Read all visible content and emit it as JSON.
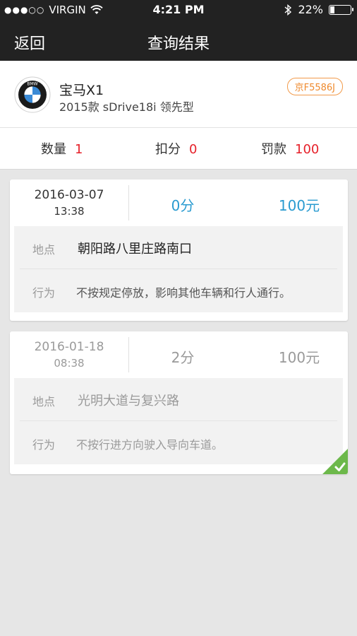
{
  "status_bar": {
    "signal": "●●●○○",
    "carrier": "VIRGIN",
    "time": "4:21 PM",
    "battery": "22%",
    "battery_level": 0.22
  },
  "nav": {
    "back_label": "返回",
    "title": "查询结果"
  },
  "car": {
    "name": "宝马X1",
    "model": "2015款 sDrive18i 领先型",
    "plate": "京F5586J",
    "logo_text": "BMW"
  },
  "summary": {
    "count_label": "数量",
    "count_value": "1",
    "points_label": "扣分",
    "points_value": "0",
    "fine_label": "罚款",
    "fine_value": "100"
  },
  "violations": [
    {
      "date": "2016-03-07",
      "time": "13:38",
      "points": "0分",
      "fine": "100元",
      "location_label": "地点",
      "location": "朝阳路八里庄路南口",
      "action_label": "行为",
      "action": "不按规定停放，影响其他车辆和行人通行。",
      "handled": false
    },
    {
      "date": "2016-01-18",
      "time": "08:38",
      "points": "2分",
      "fine": "100元",
      "location_label": "地点",
      "location": "光明大道与复兴路",
      "action_label": "行为",
      "action": "不按行进方向驶入导向车道。",
      "handled": true
    }
  ],
  "colors": {
    "accent_blue": "#2a9bd0",
    "alert_red": "#e6212a",
    "plate_orange": "#ef8a2e",
    "handled_green": "#6cb84a",
    "header_dark": "#222222"
  }
}
